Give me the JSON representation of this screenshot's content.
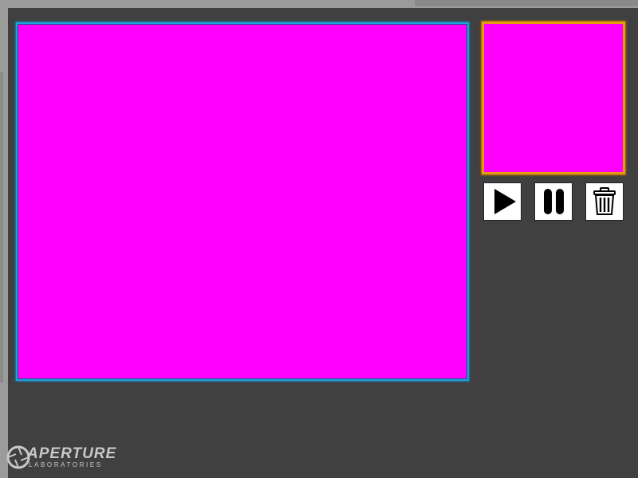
{
  "colors": {
    "frame": "#9b9b9b",
    "panel": "#404040",
    "canvas_fill": "#ff00ff",
    "main_border": "#1fa0d8",
    "preview_border": "#e59a10"
  },
  "controls": {
    "play": {
      "icon": "play-icon"
    },
    "pause": {
      "icon": "pause-icon"
    },
    "delete": {
      "icon": "trash-icon"
    }
  },
  "logo": {
    "word_first": "A",
    "word_rest": "PERTURE",
    "subtitle": "LABORATORIES"
  }
}
